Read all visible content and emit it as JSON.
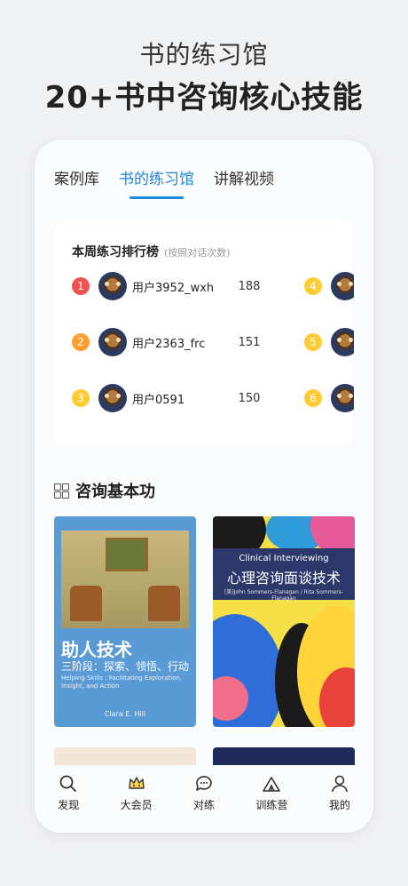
{
  "promo": {
    "subtitle": "书的练习馆",
    "headline": "20+书中咨询核心技能"
  },
  "tabs": [
    "案例库",
    "书的练习馆",
    "讲解视频"
  ],
  "ranking": {
    "title": "本周练习排行榜",
    "note": "(按照对话次数)",
    "left": [
      {
        "rank": "1",
        "name": "用户3952_wxh",
        "count": "188",
        "color": "#ef5350"
      },
      {
        "rank": "2",
        "name": "用户2363_frc",
        "count": "151",
        "color": "#ff9f2d"
      },
      {
        "rank": "3",
        "name": "用户0591",
        "count": "150",
        "color": "#ffcc33"
      }
    ],
    "right": [
      {
        "rank": "4",
        "color": "#ffcc33"
      },
      {
        "rank": "5",
        "color": "#ffcc33"
      },
      {
        "rank": "6",
        "color": "#ffcc33"
      }
    ]
  },
  "section": {
    "title": "咨询基本功"
  },
  "books": [
    {
      "title": "助人技术",
      "subtitle": "三阶段：探索、领悟、行动",
      "english": "Helping Skills : Facilitating Exploration, Insight, and Action",
      "author": "Clara E. Hill"
    },
    {
      "english": "Clinical Interviewing",
      "title": "心理咨询面谈技术",
      "authors": "[美]John Sommers-Flanagan / Rita Sommers-Flanagan"
    }
  ],
  "nav": [
    {
      "label": "发现",
      "icon": "search-icon"
    },
    {
      "label": "大会员",
      "icon": "crown-icon"
    },
    {
      "label": "对练",
      "icon": "chat-icon"
    },
    {
      "label": "训练营",
      "icon": "tent-icon"
    },
    {
      "label": "我的",
      "icon": "user-icon"
    }
  ]
}
